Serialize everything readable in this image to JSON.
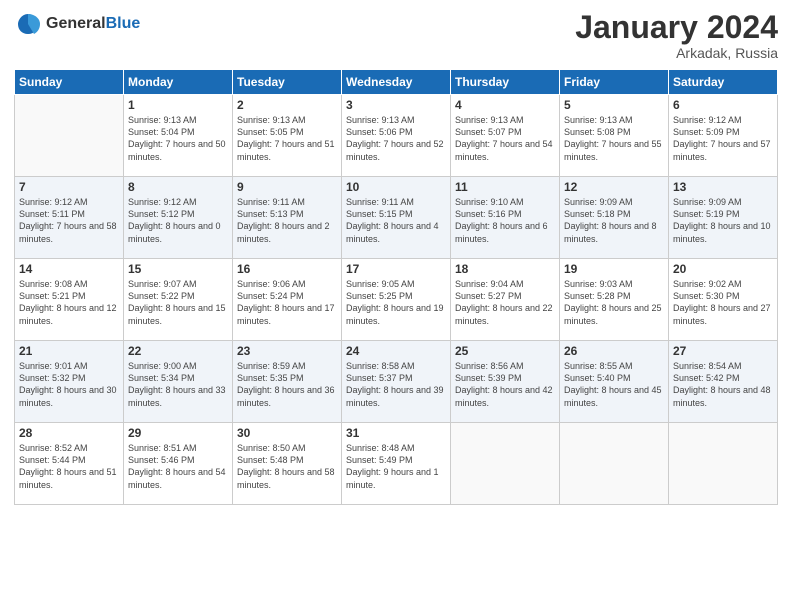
{
  "logo": {
    "general": "General",
    "blue": "Blue"
  },
  "title": "January 2024",
  "subtitle": "Arkadak, Russia",
  "headers": [
    "Sunday",
    "Monday",
    "Tuesday",
    "Wednesday",
    "Thursday",
    "Friday",
    "Saturday"
  ],
  "weeks": [
    [
      {
        "day": "",
        "sunrise": "",
        "sunset": "",
        "daylight": ""
      },
      {
        "day": "1",
        "sunrise": "Sunrise: 9:13 AM",
        "sunset": "Sunset: 5:04 PM",
        "daylight": "Daylight: 7 hours and 50 minutes."
      },
      {
        "day": "2",
        "sunrise": "Sunrise: 9:13 AM",
        "sunset": "Sunset: 5:05 PM",
        "daylight": "Daylight: 7 hours and 51 minutes."
      },
      {
        "day": "3",
        "sunrise": "Sunrise: 9:13 AM",
        "sunset": "Sunset: 5:06 PM",
        "daylight": "Daylight: 7 hours and 52 minutes."
      },
      {
        "day": "4",
        "sunrise": "Sunrise: 9:13 AM",
        "sunset": "Sunset: 5:07 PM",
        "daylight": "Daylight: 7 hours and 54 minutes."
      },
      {
        "day": "5",
        "sunrise": "Sunrise: 9:13 AM",
        "sunset": "Sunset: 5:08 PM",
        "daylight": "Daylight: 7 hours and 55 minutes."
      },
      {
        "day": "6",
        "sunrise": "Sunrise: 9:12 AM",
        "sunset": "Sunset: 5:09 PM",
        "daylight": "Daylight: 7 hours and 57 minutes."
      }
    ],
    [
      {
        "day": "7",
        "sunrise": "Sunrise: 9:12 AM",
        "sunset": "Sunset: 5:11 PM",
        "daylight": "Daylight: 7 hours and 58 minutes."
      },
      {
        "day": "8",
        "sunrise": "Sunrise: 9:12 AM",
        "sunset": "Sunset: 5:12 PM",
        "daylight": "Daylight: 8 hours and 0 minutes."
      },
      {
        "day": "9",
        "sunrise": "Sunrise: 9:11 AM",
        "sunset": "Sunset: 5:13 PM",
        "daylight": "Daylight: 8 hours and 2 minutes."
      },
      {
        "day": "10",
        "sunrise": "Sunrise: 9:11 AM",
        "sunset": "Sunset: 5:15 PM",
        "daylight": "Daylight: 8 hours and 4 minutes."
      },
      {
        "day": "11",
        "sunrise": "Sunrise: 9:10 AM",
        "sunset": "Sunset: 5:16 PM",
        "daylight": "Daylight: 8 hours and 6 minutes."
      },
      {
        "day": "12",
        "sunrise": "Sunrise: 9:09 AM",
        "sunset": "Sunset: 5:18 PM",
        "daylight": "Daylight: 8 hours and 8 minutes."
      },
      {
        "day": "13",
        "sunrise": "Sunrise: 9:09 AM",
        "sunset": "Sunset: 5:19 PM",
        "daylight": "Daylight: 8 hours and 10 minutes."
      }
    ],
    [
      {
        "day": "14",
        "sunrise": "Sunrise: 9:08 AM",
        "sunset": "Sunset: 5:21 PM",
        "daylight": "Daylight: 8 hours and 12 minutes."
      },
      {
        "day": "15",
        "sunrise": "Sunrise: 9:07 AM",
        "sunset": "Sunset: 5:22 PM",
        "daylight": "Daylight: 8 hours and 15 minutes."
      },
      {
        "day": "16",
        "sunrise": "Sunrise: 9:06 AM",
        "sunset": "Sunset: 5:24 PM",
        "daylight": "Daylight: 8 hours and 17 minutes."
      },
      {
        "day": "17",
        "sunrise": "Sunrise: 9:05 AM",
        "sunset": "Sunset: 5:25 PM",
        "daylight": "Daylight: 8 hours and 19 minutes."
      },
      {
        "day": "18",
        "sunrise": "Sunrise: 9:04 AM",
        "sunset": "Sunset: 5:27 PM",
        "daylight": "Daylight: 8 hours and 22 minutes."
      },
      {
        "day": "19",
        "sunrise": "Sunrise: 9:03 AM",
        "sunset": "Sunset: 5:28 PM",
        "daylight": "Daylight: 8 hours and 25 minutes."
      },
      {
        "day": "20",
        "sunrise": "Sunrise: 9:02 AM",
        "sunset": "Sunset: 5:30 PM",
        "daylight": "Daylight: 8 hours and 27 minutes."
      }
    ],
    [
      {
        "day": "21",
        "sunrise": "Sunrise: 9:01 AM",
        "sunset": "Sunset: 5:32 PM",
        "daylight": "Daylight: 8 hours and 30 minutes."
      },
      {
        "day": "22",
        "sunrise": "Sunrise: 9:00 AM",
        "sunset": "Sunset: 5:34 PM",
        "daylight": "Daylight: 8 hours and 33 minutes."
      },
      {
        "day": "23",
        "sunrise": "Sunrise: 8:59 AM",
        "sunset": "Sunset: 5:35 PM",
        "daylight": "Daylight: 8 hours and 36 minutes."
      },
      {
        "day": "24",
        "sunrise": "Sunrise: 8:58 AM",
        "sunset": "Sunset: 5:37 PM",
        "daylight": "Daylight: 8 hours and 39 minutes."
      },
      {
        "day": "25",
        "sunrise": "Sunrise: 8:56 AM",
        "sunset": "Sunset: 5:39 PM",
        "daylight": "Daylight: 8 hours and 42 minutes."
      },
      {
        "day": "26",
        "sunrise": "Sunrise: 8:55 AM",
        "sunset": "Sunset: 5:40 PM",
        "daylight": "Daylight: 8 hours and 45 minutes."
      },
      {
        "day": "27",
        "sunrise": "Sunrise: 8:54 AM",
        "sunset": "Sunset: 5:42 PM",
        "daylight": "Daylight: 8 hours and 48 minutes."
      }
    ],
    [
      {
        "day": "28",
        "sunrise": "Sunrise: 8:52 AM",
        "sunset": "Sunset: 5:44 PM",
        "daylight": "Daylight: 8 hours and 51 minutes."
      },
      {
        "day": "29",
        "sunrise": "Sunrise: 8:51 AM",
        "sunset": "Sunset: 5:46 PM",
        "daylight": "Daylight: 8 hours and 54 minutes."
      },
      {
        "day": "30",
        "sunrise": "Sunrise: 8:50 AM",
        "sunset": "Sunset: 5:48 PM",
        "daylight": "Daylight: 8 hours and 58 minutes."
      },
      {
        "day": "31",
        "sunrise": "Sunrise: 8:48 AM",
        "sunset": "Sunset: 5:49 PM",
        "daylight": "Daylight: 9 hours and 1 minute."
      },
      {
        "day": "",
        "sunrise": "",
        "sunset": "",
        "daylight": ""
      },
      {
        "day": "",
        "sunrise": "",
        "sunset": "",
        "daylight": ""
      },
      {
        "day": "",
        "sunrise": "",
        "sunset": "",
        "daylight": ""
      }
    ]
  ]
}
